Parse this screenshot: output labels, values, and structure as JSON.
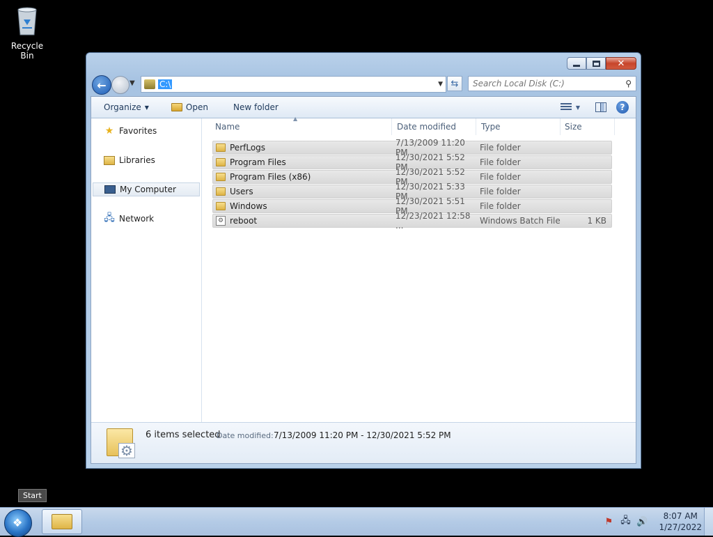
{
  "desktop": {
    "recycle_bin_label": "Recycle Bin"
  },
  "window": {
    "address": {
      "path": "C:\\"
    },
    "search": {
      "placeholder": "Search Local Disk (C:)"
    },
    "toolbar": {
      "organize": "Organize",
      "open": "Open",
      "new_folder": "New folder"
    },
    "nav": {
      "items": [
        {
          "label": "Favorites",
          "icon": "star-icon"
        },
        {
          "label": "Libraries",
          "icon": "libraries-icon"
        },
        {
          "label": "My Computer",
          "icon": "computer-icon",
          "selected": true
        },
        {
          "label": "Network",
          "icon": "network-icon"
        }
      ]
    },
    "columns": {
      "name": "Name",
      "date_modified": "Date modified",
      "type": "Type",
      "size": "Size"
    },
    "files": [
      {
        "name": "PerfLogs",
        "date": "7/13/2009 11:20 PM",
        "type": "File folder",
        "size": "",
        "icon": "folder-icon"
      },
      {
        "name": "Program Files",
        "date": "12/30/2021 5:52 PM",
        "type": "File folder",
        "size": "",
        "icon": "folder-icon"
      },
      {
        "name": "Program Files (x86)",
        "date": "12/30/2021 5:52 PM",
        "type": "File folder",
        "size": "",
        "icon": "folder-icon"
      },
      {
        "name": "Users",
        "date": "12/30/2021 5:33 PM",
        "type": "File folder",
        "size": "",
        "icon": "folder-icon"
      },
      {
        "name": "Windows",
        "date": "12/30/2021 5:51 PM",
        "type": "File folder",
        "size": "",
        "icon": "folder-icon"
      },
      {
        "name": "reboot",
        "date": "12/23/2021 12:58 ...",
        "type": "Windows Batch File",
        "size": "1 KB",
        "icon": "batch-file-icon"
      }
    ],
    "details": {
      "count": "6 items selected",
      "label": "Date modified:",
      "value": "7/13/2009 11:20 PM - 12/30/2021 5:52 PM"
    }
  },
  "tooltip": {
    "text": "Start"
  },
  "taskbar": {
    "time": "8:07 AM",
    "date": "1/27/2022"
  }
}
